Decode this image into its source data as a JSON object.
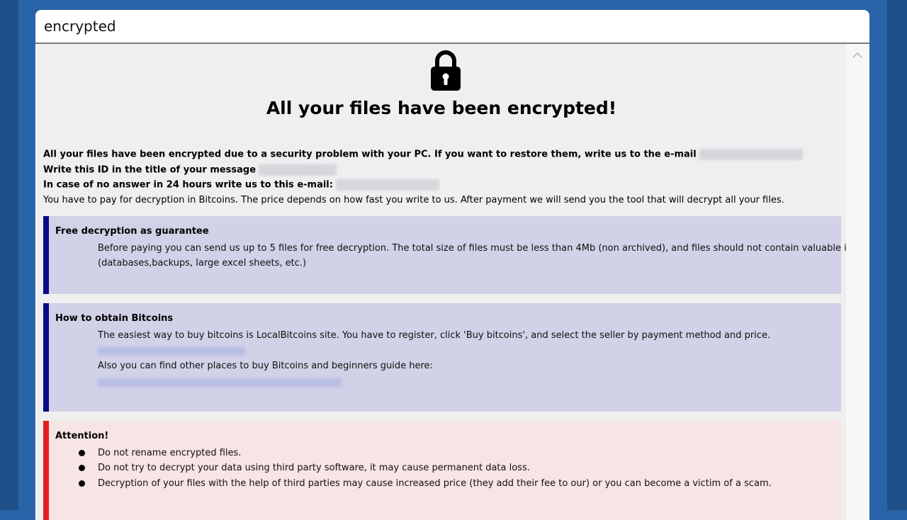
{
  "window": {
    "title": "encrypted"
  },
  "headline": "All your files have been encrypted!",
  "intro": {
    "line1": "All your files have been encrypted due to a security problem with your PC. If you want to restore them, write us to the e-mail",
    "line2": "Write this ID in the title of your message",
    "line3": "In case of no answer in 24 hours write us to this e-mail:",
    "line4": "You have to pay for decryption in Bitcoins. The price depends on how fast you write to us. After payment we will send you the tool that will decrypt all your files."
  },
  "guarantee": {
    "title": "Free decryption as guarantee",
    "text1": "Before paying you can send us up to 5 files for free decryption. The total size of files must be less than 4Mb (non archived), and files should not contain valuable information.",
    "text2": "(databases,backups, large excel sheets, etc.)"
  },
  "bitcoins": {
    "title": "How to obtain Bitcoins",
    "text1": "The easiest way to buy bitcoins is LocalBitcoins site. You have to register, click 'Buy bitcoins', and select the seller by payment method and price.",
    "text2": "Also you can find other places to buy Bitcoins and beginners guide here:"
  },
  "attention": {
    "title": "Attention!",
    "items": [
      "Do not rename encrypted files.",
      "Do not try to decrypt your data using third party software, it may cause permanent data loss.",
      "Decryption of your files with the help of third parties may cause increased price (they add their fee to our) or you can become a victim of a scam."
    ]
  },
  "icons": {
    "lock": "padlock-icon",
    "scroll_up": "chevron-up-icon"
  },
  "colors": {
    "desktop": "#2a64a8",
    "info_box_border": "#0a0a88",
    "info_box_bg": "#d1d1e7",
    "warning_border": "#e32020",
    "warning_bg": "#f7e4e4"
  }
}
